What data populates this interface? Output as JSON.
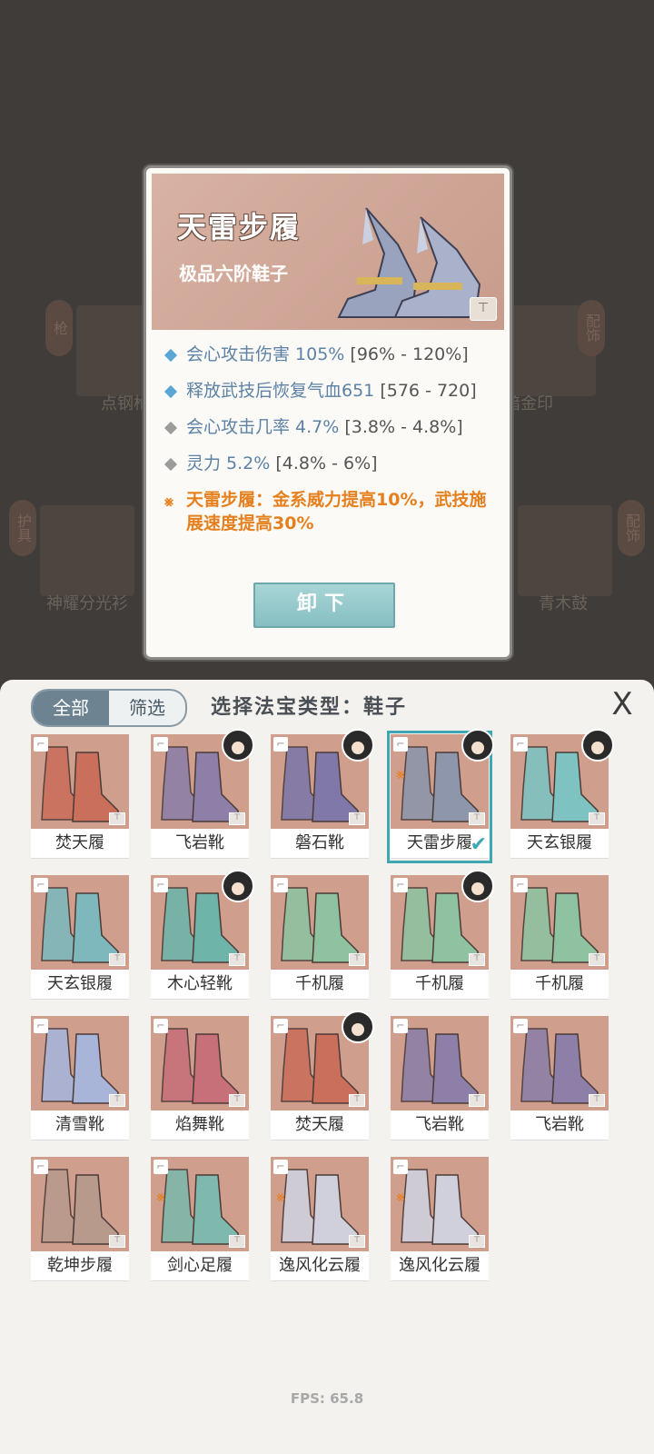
{
  "background": {
    "slots": [
      {
        "label": "点钢枪",
        "tag": "枪"
      },
      {
        "label": "暗金印",
        "tag": "配饰"
      },
      {
        "label": "神耀分光衫",
        "tag": "护具"
      },
      {
        "label": "青木鼓",
        "tag": "配饰"
      }
    ]
  },
  "popup": {
    "title": "天雷步履",
    "subtitle": "极品六阶鞋子",
    "stats": [
      {
        "text": "会心攻击伤害 105%",
        "range": "[96% - 120%]",
        "bullet_color": "#5aa7d6"
      },
      {
        "text": "释放武技后恢复气血651",
        "range": "[576 - 720]",
        "bullet_color": "#5aa7d6"
      },
      {
        "text": "会心攻击几率 4.7%",
        "range": "[3.8% - 4.8%]",
        "bullet_color": "#9b9b9b"
      },
      {
        "text": "灵力 5.2%",
        "range": "[4.8% - 6%]",
        "bullet_color": "#9b9b9b"
      }
    ],
    "set_effect": "天雷步履：金系威力提高10%，武技施展速度提高30%",
    "unequip_label": "卸下"
  },
  "panel": {
    "tab_all": "全部",
    "tab_filter": "筛选",
    "title": "选择法宝类型：鞋子",
    "close_label": "X",
    "items": [
      {
        "name": "焚天履",
        "color": "#c96f5c",
        "avatar": false,
        "selected": false,
        "set": false
      },
      {
        "name": "飞岩靴",
        "color": "#8e7fa8",
        "avatar": true,
        "selected": false,
        "set": false
      },
      {
        "name": "磐石靴",
        "color": "#7f78a8",
        "avatar": true,
        "selected": false,
        "set": false
      },
      {
        "name": "天雷步履",
        "color": "#8d96aa",
        "avatar": true,
        "selected": true,
        "set": true
      },
      {
        "name": "天玄银履",
        "color": "#7fc2c2",
        "avatar": true,
        "selected": false,
        "set": false
      },
      {
        "name": "天玄银履",
        "color": "#7fb8bc",
        "avatar": false,
        "selected": false,
        "set": false
      },
      {
        "name": "木心轻靴",
        "color": "#6fb4a8",
        "avatar": true,
        "selected": false,
        "set": false
      },
      {
        "name": "千机履",
        "color": "#8fc2a0",
        "avatar": false,
        "selected": false,
        "set": false
      },
      {
        "name": "千机履",
        "color": "#8fc2a0",
        "avatar": true,
        "selected": false,
        "set": false
      },
      {
        "name": "千机履",
        "color": "#8fc2a0",
        "avatar": false,
        "selected": false,
        "set": false
      },
      {
        "name": "清雪靴",
        "color": "#a8b4d8",
        "avatar": false,
        "selected": false,
        "set": false
      },
      {
        "name": "焰舞靴",
        "color": "#c8707a",
        "avatar": false,
        "selected": false,
        "set": false
      },
      {
        "name": "焚天履",
        "color": "#c96f5c",
        "avatar": true,
        "selected": false,
        "set": false
      },
      {
        "name": "飞岩靴",
        "color": "#8e7fa8",
        "avatar": false,
        "selected": false,
        "set": false
      },
      {
        "name": "飞岩靴",
        "color": "#8e7fa8",
        "avatar": false,
        "selected": false,
        "set": false
      },
      {
        "name": "乾坤步履",
        "color": "#b89a8c",
        "avatar": false,
        "selected": false,
        "set": false
      },
      {
        "name": "剑心足履",
        "color": "#7fb8ac",
        "avatar": false,
        "selected": false,
        "set": true
      },
      {
        "name": "逸风化云履",
        "color": "#d0d0dc",
        "avatar": false,
        "selected": false,
        "set": true
      },
      {
        "name": "逸风化云履",
        "color": "#d0d0dc",
        "avatar": false,
        "selected": false,
        "set": true
      }
    ]
  },
  "fps": "FPS: 65.8"
}
